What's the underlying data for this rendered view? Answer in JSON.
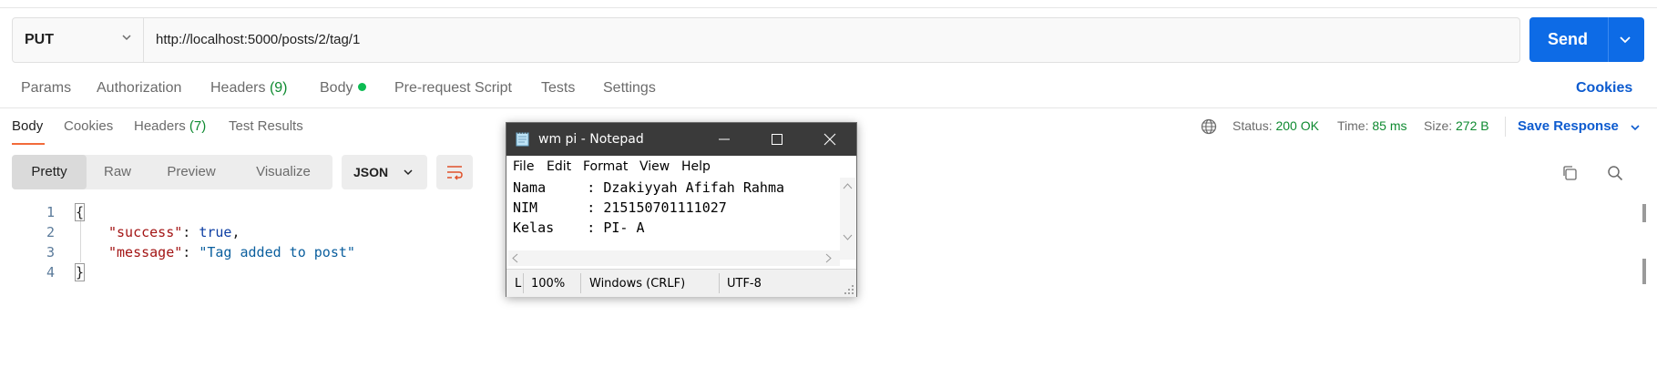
{
  "request": {
    "method": "PUT",
    "url": "http://localhost:5000/posts/2/tag/1",
    "send_label": "Send",
    "tabs": [
      {
        "label": "Params"
      },
      {
        "label": "Authorization"
      },
      {
        "label": "Headers",
        "count": "(9)"
      },
      {
        "label": "Body"
      },
      {
        "label": "Pre-request Script"
      },
      {
        "label": "Tests"
      },
      {
        "label": "Settings"
      }
    ],
    "cookies_link": "Cookies"
  },
  "response": {
    "tabs": [
      {
        "label": "Body"
      },
      {
        "label": "Cookies"
      },
      {
        "label": "Headers",
        "count": "(7)"
      },
      {
        "label": "Test Results"
      }
    ],
    "status_label": "Status:",
    "status_value": "200 OK",
    "time_label": "Time:",
    "time_value": "85 ms",
    "size_label": "Size:",
    "size_value": "272 B",
    "save_label": "Save Response",
    "views": [
      "Pretty",
      "Raw",
      "Preview",
      "Visualize"
    ],
    "format": "JSON",
    "code_lines": [
      {
        "num": "1",
        "open": "{"
      },
      {
        "num": "2",
        "key": "\"success\"",
        "colon": ": ",
        "value": "true",
        "tail": ","
      },
      {
        "num": "3",
        "key": "\"message\"",
        "colon": ": ",
        "value": "\"Tag added to post\"",
        "tail": ""
      },
      {
        "num": "4",
        "close": "}"
      }
    ]
  },
  "notepad": {
    "title": "wm pi - Notepad",
    "menu": [
      "File",
      "Edit",
      "Format",
      "View",
      "Help"
    ],
    "lines": [
      "Nama     : Dzakiyyah Afifah Rahma",
      "NIM      : 215150701111027",
      "Kelas    : PI- A"
    ],
    "status": {
      "position": "L",
      "zoom": "100%",
      "line_ending": "Windows (CRLF)",
      "encoding": "UTF-8"
    }
  },
  "colors": {
    "accent": "#0d6be6",
    "status_ok": "#0e8a30",
    "tab_underline": "#f26b3a",
    "body_dot": "#0cbb52"
  }
}
